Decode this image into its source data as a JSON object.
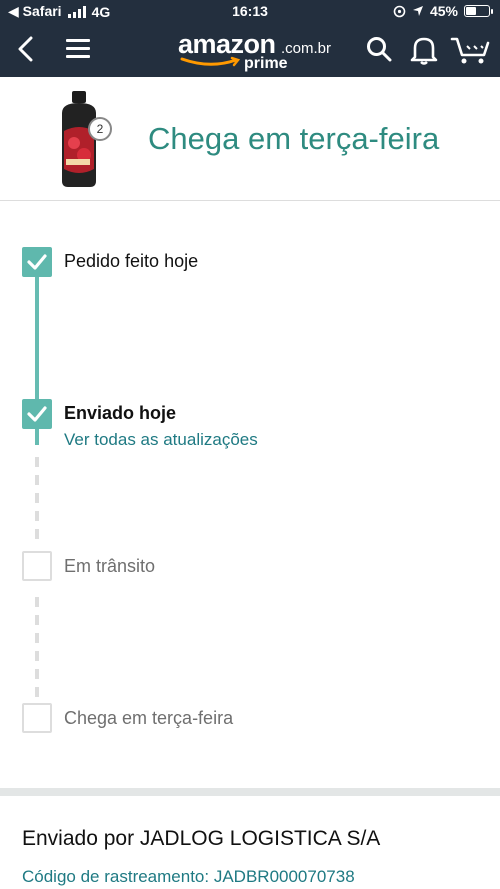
{
  "status_bar": {
    "carrier": "◀ Safari",
    "network": "4G",
    "time": "16:13",
    "battery": "45%",
    "battery_level": 0.45
  },
  "header": {
    "logo_word": "amazon",
    "logo_domain": ".com.br",
    "logo_prime": "prime",
    "icons": [
      "back-icon",
      "menu-icon",
      "search-icon",
      "bell-icon",
      "cart-icon"
    ]
  },
  "summary": {
    "headline": "Chega em terça-feira",
    "item_count": "2"
  },
  "timeline": [
    {
      "label": "Pedido feito hoje",
      "status": "done"
    },
    {
      "label": "Enviado hoje",
      "status": "done",
      "link": "Ver todas as atualizações"
    },
    {
      "label": "Em trânsito",
      "status": "pending"
    },
    {
      "label": "Chega em terça-feira",
      "status": "pending"
    }
  ],
  "shipping": {
    "carrier_text": "Enviado por JADLOG LOGISTICA S/A",
    "tracking_text": "Código de rastreamento: JADBR000070738"
  },
  "colors": {
    "header_bg": "#232f3e",
    "accent_teal": "#5fb8ad",
    "link": "#1f7a83"
  }
}
